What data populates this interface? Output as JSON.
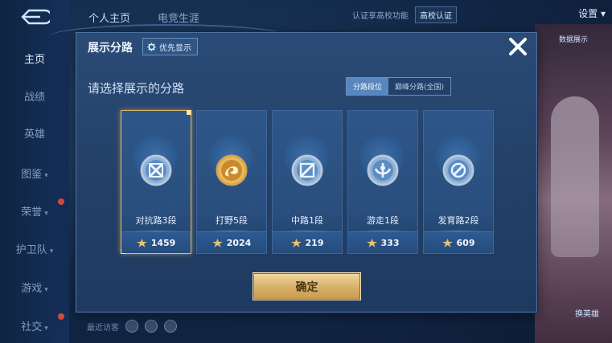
{
  "background": {
    "nav": [
      {
        "label": "主页",
        "active": true,
        "dot": false
      },
      {
        "label": "战绩",
        "active": false,
        "dot": false
      },
      {
        "label": "英雄",
        "active": false,
        "dot": false
      },
      {
        "label": "图鉴",
        "active": false,
        "dot": false
      },
      {
        "label": "荣誉",
        "active": false,
        "dot": true
      },
      {
        "label": "护卫队",
        "active": false,
        "dot": false
      },
      {
        "label": "游戏",
        "active": false,
        "dot": false
      },
      {
        "label": "社交",
        "active": false,
        "dot": true
      }
    ],
    "top_tabs": [
      "个人主页",
      "电竞生涯"
    ],
    "certify_text": "认证享高校功能",
    "school_btn": "高校认证",
    "settings": "设置",
    "right_label_top": "数据展示",
    "right_label_bottom": "换英雄",
    "visitors_label": "最近访客"
  },
  "modal": {
    "title": "展示分路",
    "priority_label": "优先显示",
    "prompt": "请选择展示的分路",
    "toggle": [
      "分路段位",
      "巅峰分路(全国)"
    ],
    "toggle_active": 0,
    "confirm_label": "确定",
    "lanes": [
      {
        "name": "对抗路3段",
        "points": "1459",
        "selected": true,
        "icon": "clash-lane-badge-icon",
        "tone": "silver"
      },
      {
        "name": "打野5段",
        "points": "2024",
        "selected": false,
        "icon": "jungle-badge-icon",
        "tone": "gold"
      },
      {
        "name": "中路1段",
        "points": "219",
        "selected": false,
        "icon": "mid-lane-badge-icon",
        "tone": "silver"
      },
      {
        "name": "游走1段",
        "points": "333",
        "selected": false,
        "icon": "roam-badge-icon",
        "tone": "silver"
      },
      {
        "name": "发育路2段",
        "points": "609",
        "selected": false,
        "icon": "farm-lane-badge-icon",
        "tone": "silver"
      }
    ]
  },
  "colors": {
    "accent_gold": "#e6b86a",
    "modal_bg": "#2a4b76",
    "selected_toggle": "#5a86c0"
  }
}
